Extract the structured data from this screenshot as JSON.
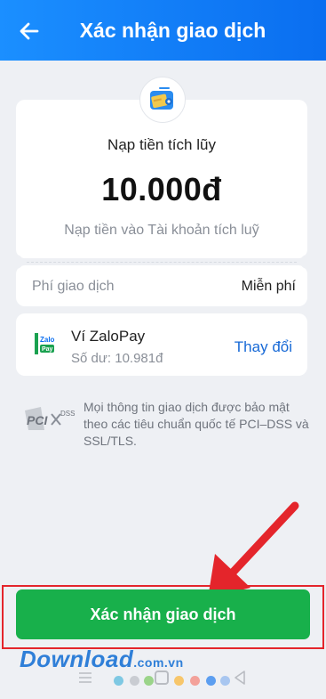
{
  "header": {
    "title": "Xác nhận giao dịch",
    "back_icon": "arrow-left-icon"
  },
  "transaction": {
    "type_label": "Nạp tiền tích lũy",
    "amount": "10.000đ",
    "description": "Nạp tiền vào Tài khoản tích luỹ",
    "fee_label": "Phí giao dịch",
    "fee_value": "Miễn phí"
  },
  "payment_method": {
    "logo_text_top": "Zalo",
    "logo_text_bottom": "Pay",
    "name": "Ví ZaloPay",
    "balance": "Số dư: 10.981đ",
    "change_label": "Thay đổi"
  },
  "security": {
    "logo_text": "PCI",
    "logo_sub": "DSS",
    "note": "Mọi thông tin giao dịch được bảo mật theo các tiêu chuẩn quốc tế PCI–DSS và SSL/TLS."
  },
  "confirm": {
    "label": "Xác nhận giao dịch"
  },
  "watermark": {
    "brand": "Download",
    "domain": ".com.vn"
  },
  "colors": {
    "header_blue": "#0a6ef0",
    "confirm_green": "#18b04b",
    "link_blue": "#1769d6",
    "annotation_red": "#e4252b"
  }
}
